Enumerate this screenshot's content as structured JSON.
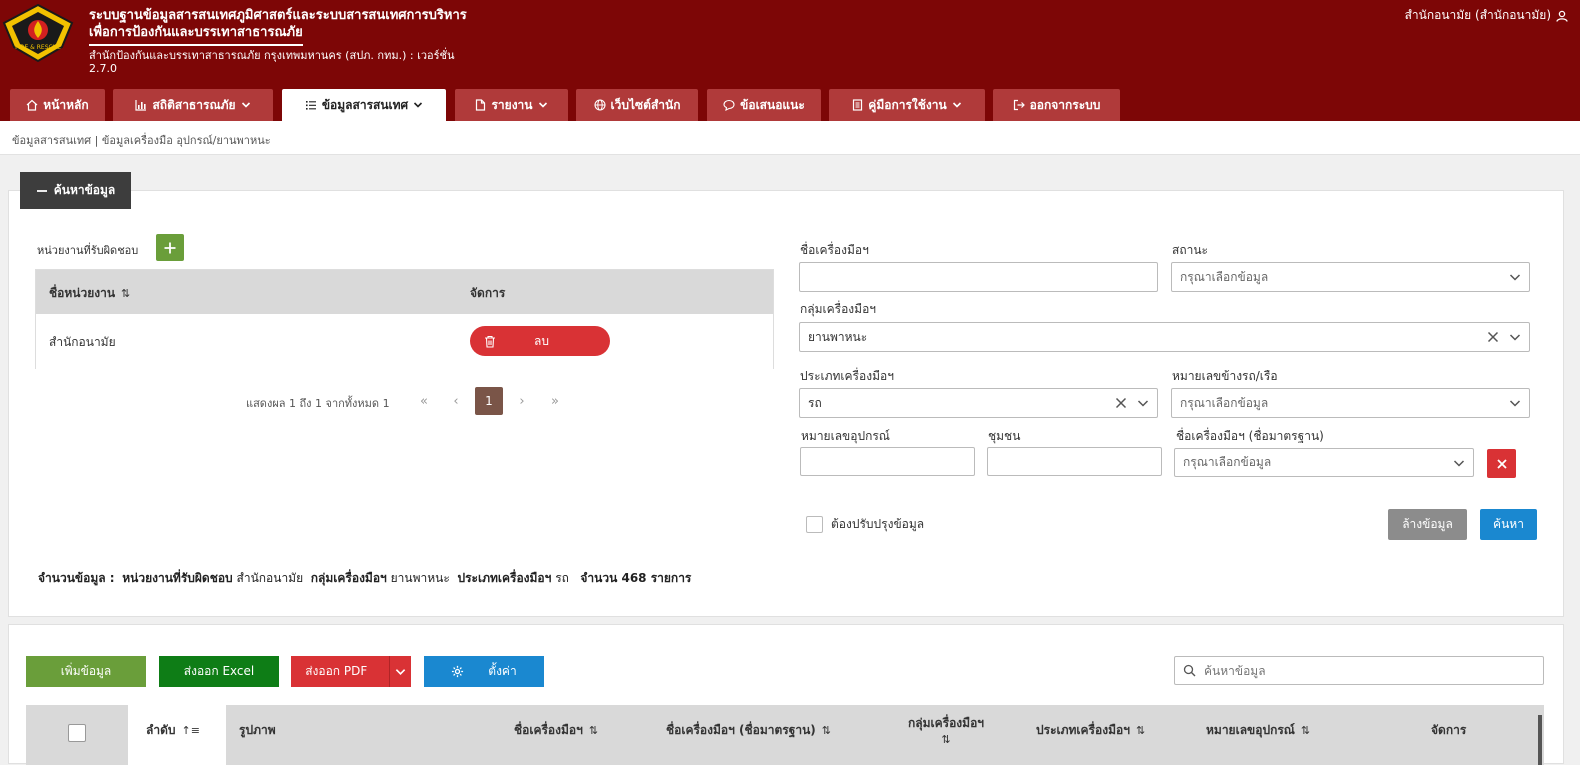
{
  "header": {
    "title_line1": "ระบบฐานข้อมูลสารสนเทศภูมิศาสตร์และระบบสารสนเทศการบริหาร",
    "title_line2": "เพื่อการป้องกันและบรรเทาสาธารณภัย",
    "org_line": "สำนักป้องกันและบรรเทาสาธารณภัย กรุงเทพมหานคร (สปภ. กทม.) : เวอร์ชั่น",
    "version": "2.7.0",
    "user": "สำนักอนามัย (สำนักอนามัย)",
    "logo_text": "FIRE & RESCUE"
  },
  "nav": {
    "tabs": [
      {
        "label": "หน้าหลัก",
        "icon": "home-icon"
      },
      {
        "label": "สถิติสาธารณภัย",
        "icon": "bar-chart-icon"
      },
      {
        "label": "ข้อมูลสารสนเทศ",
        "icon": "list-icon"
      },
      {
        "label": "รายงาน",
        "icon": "file-icon"
      },
      {
        "label": "เว็บไซต์สำนัก",
        "icon": "globe-icon"
      },
      {
        "label": "ข้อเสนอแนะ",
        "icon": "comment-icon"
      },
      {
        "label": "คู่มือการใช้งาน",
        "icon": "book-icon"
      },
      {
        "label": "ออกจากระบบ",
        "icon": "logout-icon"
      }
    ]
  },
  "breadcrumb": "ข้อมูลสารสนเทศ | ข้อมูลเครื่องมือ อุปกรณ์/ยานพาหนะ",
  "search": {
    "toggle_label": "ค้นหาข้อมูล",
    "unit_label": "หน่วยงานที่รับผิดชอบ",
    "unit_table": {
      "col_name": "ชื่อหน่วยงาน",
      "col_manage": "จัดการ",
      "rows": [
        {
          "name": "สำนักอนามัย",
          "action": "ลบ"
        }
      ]
    },
    "pager": {
      "text": "แสดงผล 1 ถึง 1 จากทั้งหมด 1",
      "current": "1"
    },
    "tool_name_label": "ชื่อเครื่องมือฯ",
    "tool_name_value": "",
    "status_label": "สถานะ",
    "status_placeholder": "กรุณาเลือกข้อมูล",
    "group_label": "กลุ่มเครื่องมือฯ",
    "group_value": "ยานพาหนะ",
    "type_label": "ประเภทเครื่องมือฯ",
    "type_value": "รถ",
    "plate_label": "หมายเลขข้างรถ/เรือ",
    "plate_placeholder": "กรุณาเลือกข้อมูล",
    "device_no_label": "หมายเลขอุปกรณ์",
    "device_no_value": "",
    "community_label": "ชุมชน",
    "community_value": "",
    "std_name_label": "ชื่อเครื่องมือฯ (ชื่อมาตรฐาน)",
    "std_name_placeholder": "กรุณาเลือกข้อมูล",
    "needs_update_label": "ต้องปรับปรุงข้อมูล",
    "clear_label": "ล้างข้อมูล",
    "search_label": "ค้นหา"
  },
  "summary": {
    "prefix": "จำนวนข้อมูล :",
    "unit_key": "หน่วยงานที่รับผิดชอบ",
    "unit_val": "สำนักอนามัย",
    "group_key": "กลุ่มเครื่องมือฯ",
    "group_val": "ยานพาหนะ",
    "type_key": "ประเภทเครื่องมือฯ",
    "type_val": "รถ",
    "count_text": "จำนวน 468 รายการ"
  },
  "results": {
    "add_label": "เพิ่มข้อมูล",
    "excel_label": "ส่งออก Excel",
    "pdf_label": "ส่งออก PDF",
    "settings_label": "ตั้งค่า",
    "search_placeholder": "ค้นหาข้อมูล",
    "columns": {
      "order": "ลำดับ",
      "image": "รูปภาพ",
      "name": "ชื่อเครื่องมือฯ",
      "std_name": "ชื่อเครื่องมือฯ (ชื่อมาตรฐาน)",
      "group": "กลุ่มเครื่องมือฯ",
      "type": "ประเภทเครื่องมือฯ",
      "device_no": "หมายเลขอุปกรณ์",
      "manage": "จัดการ"
    }
  },
  "colors": {
    "header_bg": "#7d0606",
    "tab_bg": "#b03a3a",
    "green": "#6a9e3a",
    "dark_green": "#0e7d16",
    "red": "#d93235",
    "blue": "#1a88d0",
    "gray_btn": "#8c8c8c"
  }
}
